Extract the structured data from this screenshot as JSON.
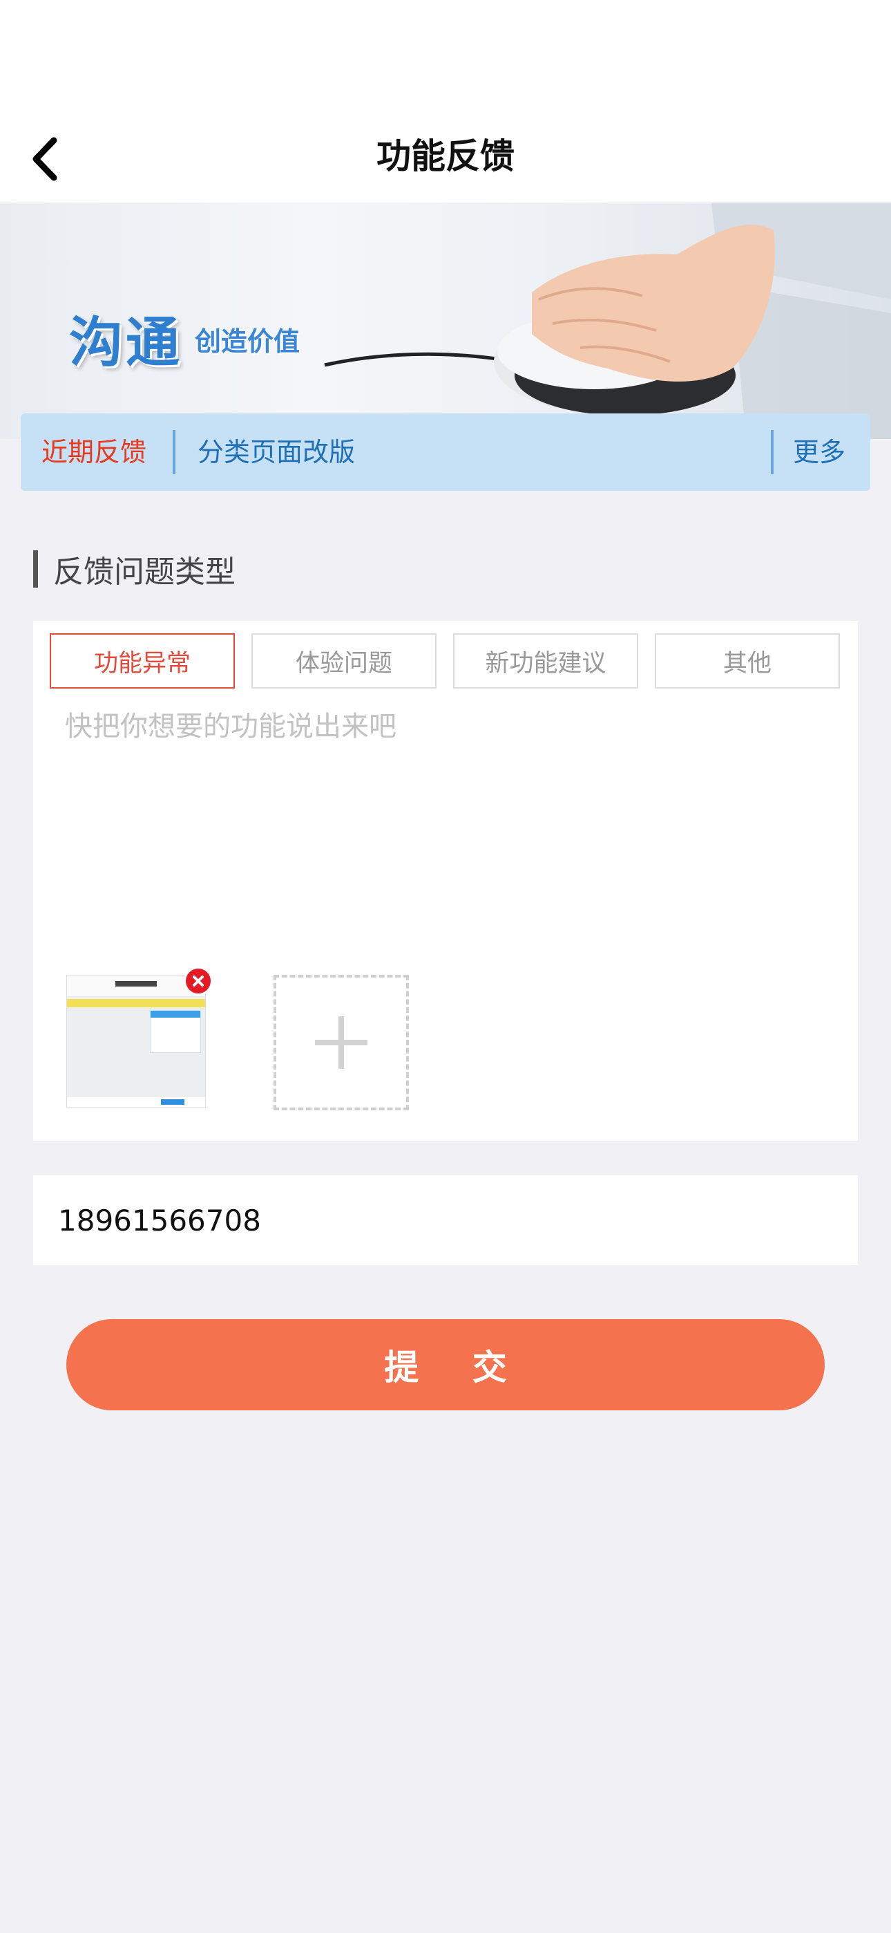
{
  "nav": {
    "title": "功能反馈"
  },
  "banner": {
    "headline": "沟通",
    "subline": "创造价值"
  },
  "notice": {
    "tag": "近期反馈",
    "text": "分类页面改版",
    "more": "更多"
  },
  "section": {
    "title": "反馈问题类型"
  },
  "types": [
    {
      "label": "功能异常",
      "selected": true
    },
    {
      "label": "体验问题",
      "selected": false
    },
    {
      "label": "新功能建议",
      "selected": false
    },
    {
      "label": "其他",
      "selected": false
    }
  ],
  "feedback": {
    "placeholder": "快把你想要的功能说出来吧",
    "value": ""
  },
  "phone": {
    "value": "18961566708"
  },
  "submit": {
    "label": "提 交"
  },
  "colors": {
    "accent": "#f4724e",
    "selected_chip": "#e24a3b",
    "notice_bg": "#c6e1f5",
    "notice_link": "#1f6fb5",
    "notice_tag": "#e8391d"
  }
}
